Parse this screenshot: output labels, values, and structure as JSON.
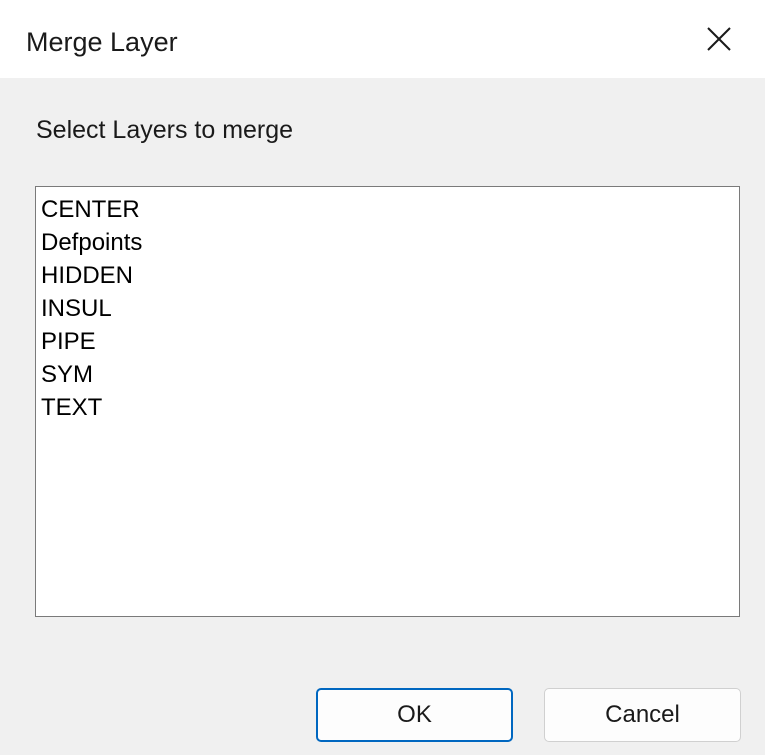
{
  "window": {
    "title": "Merge Layer",
    "close_icon": "close-icon"
  },
  "prompt": {
    "label": "Select Layers to merge"
  },
  "layers": {
    "items": [
      "CENTER",
      "Defpoints",
      "HIDDEN",
      "INSUL",
      "PIPE",
      "SYM",
      "TEXT"
    ]
  },
  "buttons": {
    "ok_label": "OK",
    "cancel_label": "Cancel"
  },
  "colors": {
    "accent": "#0067c0",
    "dialog_bg": "#f0f0f0",
    "list_border": "#7a7a7a"
  }
}
